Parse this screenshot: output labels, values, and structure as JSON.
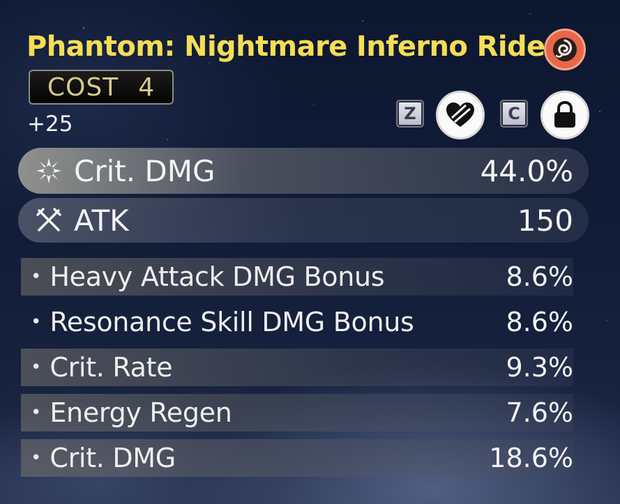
{
  "echo": {
    "title": "Phantom: Nightmare Inferno Rider",
    "cost_label": "COST",
    "cost_value": "4",
    "level": "+25",
    "element_icon": "fusion-element-icon",
    "accent_color": "#f5dd55"
  },
  "actions": {
    "discard_key": "Z",
    "lock_key": "C"
  },
  "main_stats": [
    {
      "icon": "crit-dmg-icon",
      "name": "Crit. DMG",
      "value": "44.0%"
    },
    {
      "icon": "atk-swords-icon",
      "name": "ATK",
      "value": "150"
    }
  ],
  "sub_stats": [
    {
      "name": "Heavy Attack DMG Bonus",
      "value": "8.6%"
    },
    {
      "name": "Resonance Skill DMG Bonus",
      "value": "8.6%"
    },
    {
      "name": "Crit. Rate",
      "value": "9.3%"
    },
    {
      "name": "Energy Regen",
      "value": "7.6%"
    },
    {
      "name": "Crit. DMG",
      "value": "18.6%"
    }
  ]
}
